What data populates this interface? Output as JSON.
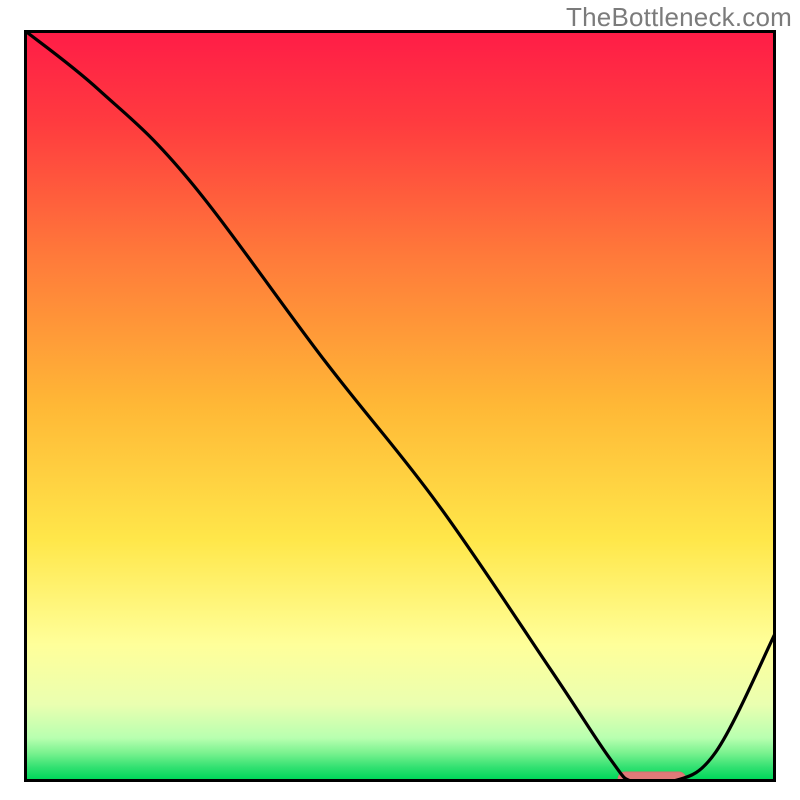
{
  "watermark": "TheBottleneck.com",
  "colors": {
    "border": "#000000",
    "curve": "#000000",
    "gradient_top": "#ff1d47",
    "gradient_mid": "#ffc100",
    "gradient_low": "#ffff9a",
    "gradient_bottom": "#00e05a",
    "marker_fill": "#e07a79",
    "marker_stroke": "#d96f6e",
    "watermark": "#7b7b7b"
  },
  "chart_data": {
    "type": "line",
    "title": "",
    "xlabel": "",
    "ylabel": "",
    "xlim": [
      0,
      100
    ],
    "ylim": [
      0,
      100
    ],
    "grid": false,
    "series": [
      {
        "name": "bottleneck-curve",
        "x": [
          0,
          10,
          22,
          40,
          55,
          70,
          78,
          81,
          86,
          92,
          100
        ],
        "y": [
          100,
          92,
          80,
          56,
          37,
          15,
          3,
          0,
          0,
          4,
          20
        ]
      }
    ],
    "optimal_marker": {
      "x_start": 79,
      "x_end": 88,
      "y": 0
    },
    "background_gradient": {
      "stops": [
        {
          "offset": 0.0,
          "color": "#ff1d47"
        },
        {
          "offset": 0.12,
          "color": "#ff3b3f"
        },
        {
          "offset": 0.3,
          "color": "#ff7a3a"
        },
        {
          "offset": 0.5,
          "color": "#ffb836"
        },
        {
          "offset": 0.68,
          "color": "#ffe74a"
        },
        {
          "offset": 0.82,
          "color": "#ffff9a"
        },
        {
          "offset": 0.9,
          "color": "#eaffb0"
        },
        {
          "offset": 0.945,
          "color": "#b8ffb0"
        },
        {
          "offset": 0.965,
          "color": "#7af28f"
        },
        {
          "offset": 0.985,
          "color": "#30e070"
        },
        {
          "offset": 1.0,
          "color": "#00d85a"
        }
      ]
    }
  }
}
